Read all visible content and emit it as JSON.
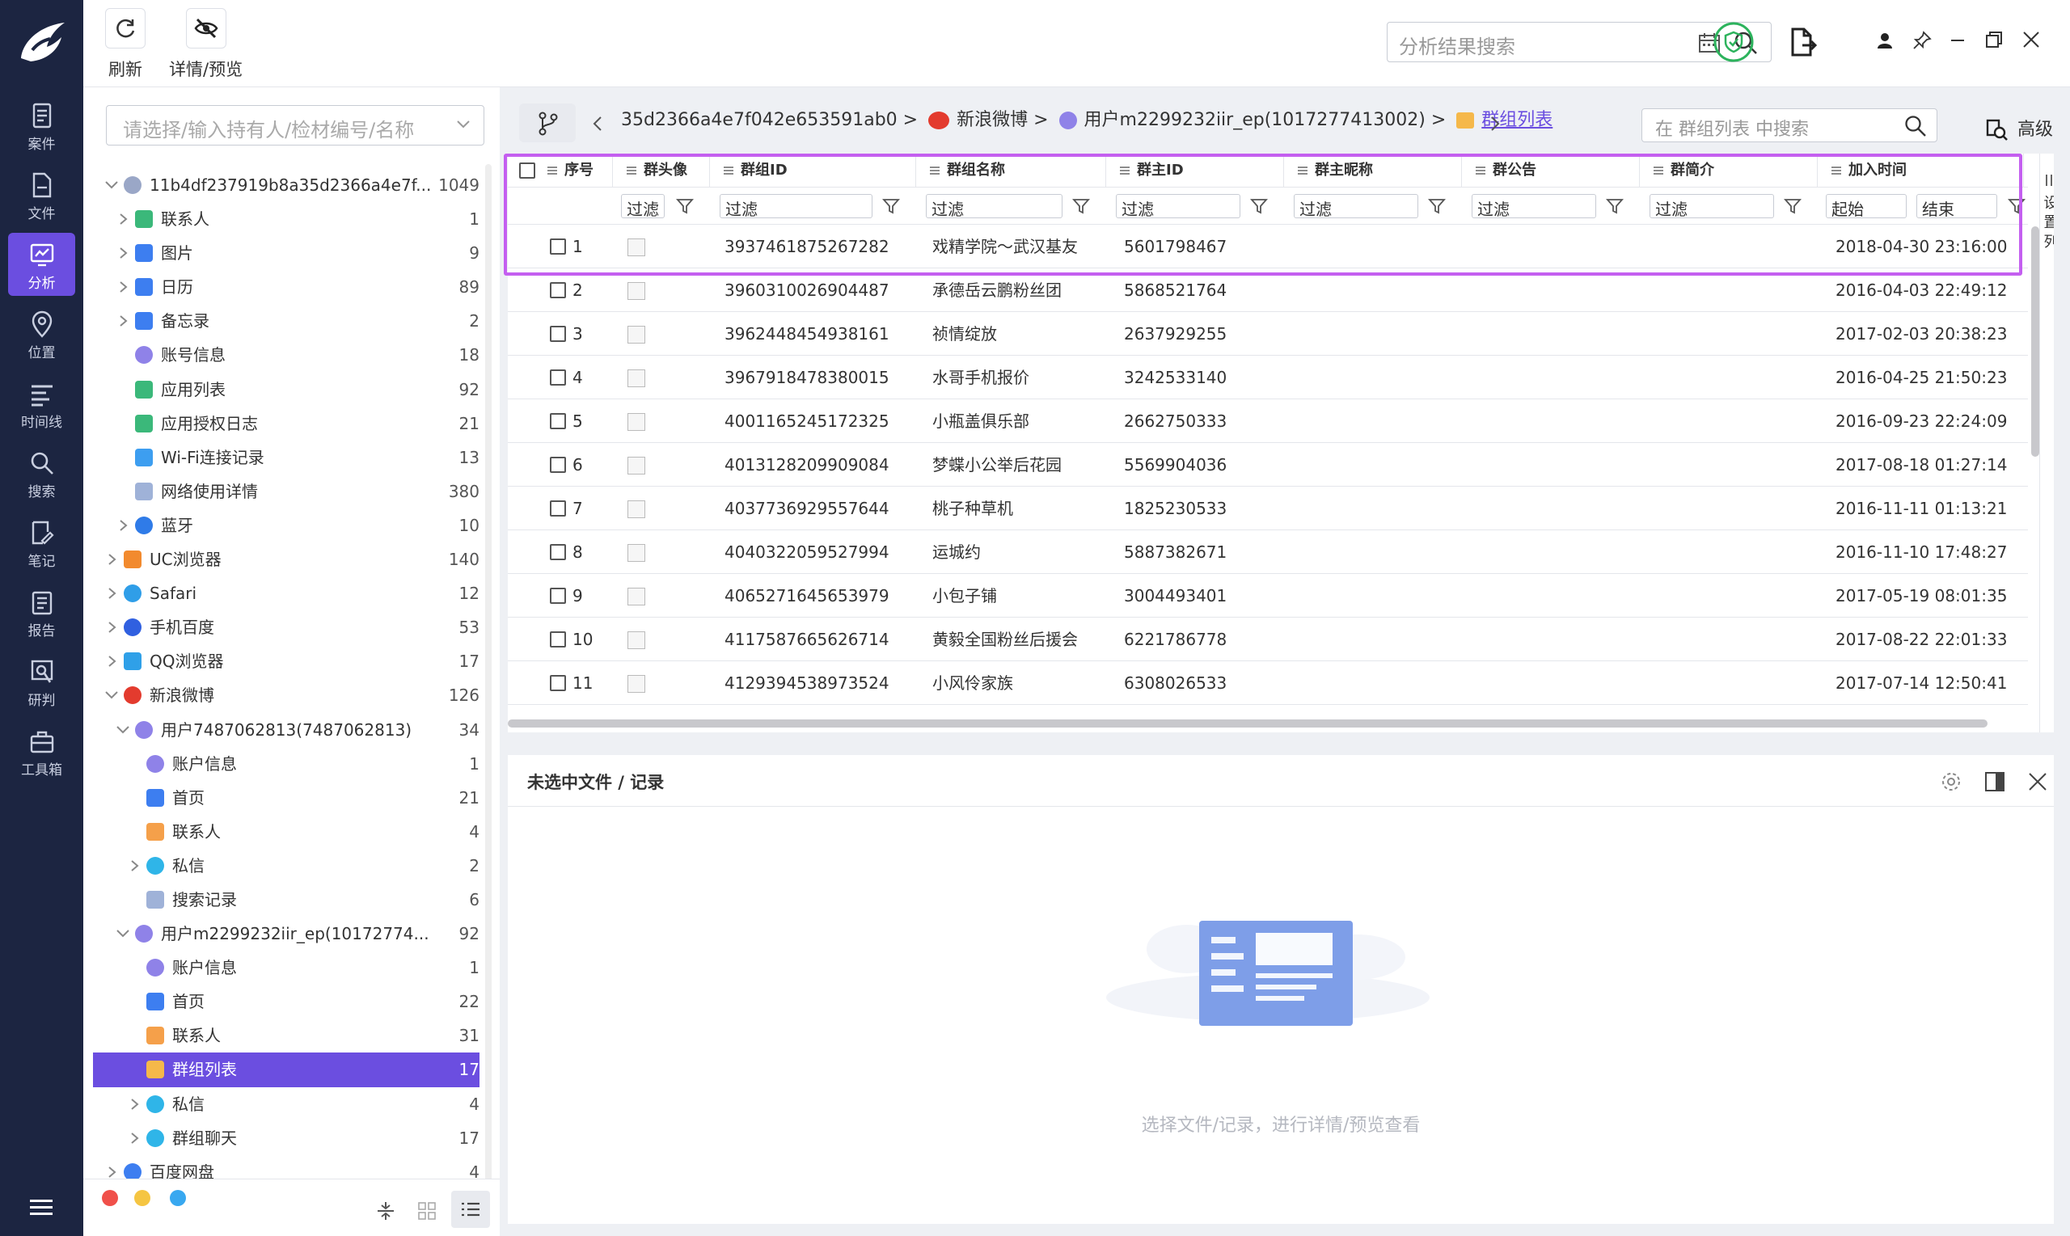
{
  "toolbar": {
    "refresh_label": "刷新",
    "detail_label": "详情/预览",
    "search_placeholder": "分析结果搜索"
  },
  "nav": [
    {
      "label": "案件",
      "icon": "case-icon"
    },
    {
      "label": "文件",
      "icon": "file-icon"
    },
    {
      "label": "分析",
      "icon": "analysis-icon",
      "active": true
    },
    {
      "label": "位置",
      "icon": "location-icon"
    },
    {
      "label": "时间线",
      "icon": "timeline-icon"
    },
    {
      "label": "搜索",
      "icon": "search-icon"
    },
    {
      "label": "笔记",
      "icon": "note-icon"
    },
    {
      "label": "报告",
      "icon": "report-icon"
    },
    {
      "label": "研判",
      "icon": "judge-icon"
    },
    {
      "label": "工具箱",
      "icon": "toolbox-icon"
    }
  ],
  "left": {
    "select_placeholder": "请选择/输入持有人/检材编号/名称",
    "tree": [
      {
        "label": "11b4df237919b8a35d2366a4e7f...",
        "count": "1049",
        "level": 0,
        "caret": "v",
        "icon": "apple-icon",
        "color": "#9aa7c7"
      },
      {
        "label": "联系人",
        "count": "1",
        "level": 1,
        "caret": ">",
        "icon": "contacts-icon",
        "color": "#3bb87a"
      },
      {
        "label": "图片",
        "count": "9",
        "level": 1,
        "caret": ">",
        "icon": "image-icon",
        "color": "#3d7ef0"
      },
      {
        "label": "日历",
        "count": "89",
        "level": 1,
        "caret": ">",
        "icon": "calendar-icon",
        "color": "#3d7ef0"
      },
      {
        "label": "备忘录",
        "count": "2",
        "level": 1,
        "caret": ">",
        "icon": "memo-icon",
        "color": "#3d7ef0"
      },
      {
        "label": "账号信息",
        "count": "18",
        "level": 1,
        "caret": "",
        "icon": "account-icon",
        "color": "#8f82e8"
      },
      {
        "label": "应用列表",
        "count": "92",
        "level": 1,
        "caret": "",
        "icon": "app-list-icon",
        "color": "#3bb87a"
      },
      {
        "label": "应用授权日志",
        "count": "21",
        "level": 1,
        "caret": "",
        "icon": "app-auth-icon",
        "color": "#3bb87a"
      },
      {
        "label": "Wi-Fi连接记录",
        "count": "13",
        "level": 1,
        "caret": "",
        "icon": "wifi-icon",
        "color": "#3d9ef0"
      },
      {
        "label": "网络使用详情",
        "count": "380",
        "level": 1,
        "caret": "",
        "icon": "network-icon",
        "color": "#9fb2d8"
      },
      {
        "label": "蓝牙",
        "count": "10",
        "level": 1,
        "caret": ">",
        "icon": "bluetooth-icon",
        "color": "#2f7be8"
      },
      {
        "label": "UC浏览器",
        "count": "140",
        "level": 0,
        "caret": ">",
        "icon": "uc-icon",
        "color": "#f28a2e"
      },
      {
        "label": "Safari",
        "count": "12",
        "level": 0,
        "caret": ">",
        "icon": "safari-icon",
        "color": "#2f9ee8"
      },
      {
        "label": "手机百度",
        "count": "53",
        "level": 0,
        "caret": ">",
        "icon": "baidu-icon",
        "color": "#3060e0"
      },
      {
        "label": "QQ浏览器",
        "count": "17",
        "level": 0,
        "caret": ">",
        "icon": "qq-browser-icon",
        "color": "#2fa0e8"
      },
      {
        "label": "新浪微博",
        "count": "126",
        "level": 0,
        "caret": "v",
        "icon": "weibo-icon",
        "color": "#e33b2e"
      },
      {
        "label": "用户7487062813(7487062813)",
        "count": "34",
        "level": 1,
        "caret": "v",
        "icon": "user-icon",
        "color": "#8f82e8"
      },
      {
        "label": "账户信息",
        "count": "1",
        "level": 2,
        "caret": "",
        "icon": "account-icon",
        "color": "#8f82e8"
      },
      {
        "label": "首页",
        "count": "21",
        "level": 2,
        "caret": "",
        "icon": "home-feed-icon",
        "color": "#3d7ef0"
      },
      {
        "label": "联系人",
        "count": "4",
        "level": 2,
        "caret": "",
        "icon": "contact-card-icon",
        "color": "#f5a04a"
      },
      {
        "label": "私信",
        "count": "2",
        "level": 2,
        "caret": ">",
        "icon": "message-icon",
        "color": "#2fb5e8"
      },
      {
        "label": "搜索记录",
        "count": "6",
        "level": 2,
        "caret": "",
        "icon": "search-history-icon",
        "color": "#9fb2d8"
      },
      {
        "label": "用户m2299232iir_ep(10172774...",
        "count": "92",
        "level": 1,
        "caret": "v",
        "icon": "user-icon",
        "color": "#8f82e8"
      },
      {
        "label": "账户信息",
        "count": "1",
        "level": 2,
        "caret": "",
        "icon": "account-icon",
        "color": "#8f82e8"
      },
      {
        "label": "首页",
        "count": "22",
        "level": 2,
        "caret": "",
        "icon": "home-feed-icon",
        "color": "#3d7ef0"
      },
      {
        "label": "联系人",
        "count": "31",
        "level": 2,
        "caret": "",
        "icon": "contact-card-icon",
        "color": "#f5a04a"
      },
      {
        "label": "群组列表",
        "count": "17",
        "level": 2,
        "caret": "",
        "icon": "group-list-icon",
        "color": "#f5b84a",
        "selected": true
      },
      {
        "label": "私信",
        "count": "4",
        "level": 2,
        "caret": ">",
        "icon": "message-icon",
        "color": "#2fb5e8"
      },
      {
        "label": "群组聊天",
        "count": "17",
        "level": 2,
        "caret": ">",
        "icon": "group-chat-icon",
        "color": "#2fb5e8"
      },
      {
        "label": "百度网盘",
        "count": "4",
        "level": 0,
        "caret": ">",
        "icon": "baidu-pan-icon",
        "color": "#3d7ef0"
      }
    ]
  },
  "breadcrumb": {
    "items": [
      "35d2366a4e7f042e653591ab0 >",
      "新浪微博 >",
      "用户m2299232iir_ep(1017277413002) >"
    ],
    "current": "群组列表",
    "search_placeholder": "在 群组列表 中搜索",
    "advanced_label": "高级"
  },
  "table": {
    "columns": [
      "序号",
      "群头像",
      "群组ID",
      "群组名称",
      "群主ID",
      "群主昵称",
      "群公告",
      "群简介",
      "加入时间"
    ],
    "filter_placeholder": "过滤",
    "time_start": "起始",
    "time_end": "结束",
    "settings_col": "设置列",
    "rows": [
      {
        "no": "1",
        "gid": "3937461875267282",
        "name": "戏精学院～武汉基友",
        "owner": "5601798467",
        "time": "2018-04-30 23:16:00"
      },
      {
        "no": "2",
        "gid": "3960310026904487",
        "name": "承德岳云鹏粉丝团",
        "owner": "5868521764",
        "time": "2016-04-03 22:49:12"
      },
      {
        "no": "3",
        "gid": "3962448454938161",
        "name": "祯情绽放",
        "owner": "2637929255",
        "time": "2017-02-03 20:38:23"
      },
      {
        "no": "4",
        "gid": "3967918478380015",
        "name": "水哥手机报价",
        "owner": "3242533140",
        "time": "2016-04-25 21:50:23"
      },
      {
        "no": "5",
        "gid": "4001165245172325",
        "name": "小瓶盖俱乐部",
        "owner": "2662750333",
        "time": "2016-09-23 22:24:09"
      },
      {
        "no": "6",
        "gid": "4013128209909084",
        "name": "梦蝶小公举后花园",
        "owner": "5569904036",
        "time": "2017-08-18 01:27:14"
      },
      {
        "no": "7",
        "gid": "4037736929557644",
        "name": "桃子种草机",
        "owner": "1825230533",
        "time": "2016-11-11 01:13:21"
      },
      {
        "no": "8",
        "gid": "4040322059527994",
        "name": "运城约",
        "owner": "5887382671",
        "time": "2016-11-10 17:48:27"
      },
      {
        "no": "9",
        "gid": "4065271645653979",
        "name": "小包子铺",
        "owner": "3004493401",
        "time": "2017-05-19 08:01:35"
      },
      {
        "no": "10",
        "gid": "4117587665626714",
        "name": "黄毅全国粉丝后援会",
        "owner": "6221786778",
        "time": "2017-08-22 22:01:33"
      },
      {
        "no": "11",
        "gid": "4129394538973524",
        "name": "小风伶家族",
        "owner": "6308026533",
        "time": "2017-07-14 12:50:41"
      }
    ]
  },
  "detail": {
    "title": "未选中文件 / 记录",
    "empty_text": "选择文件/记录，进行详情/预览查看"
  }
}
